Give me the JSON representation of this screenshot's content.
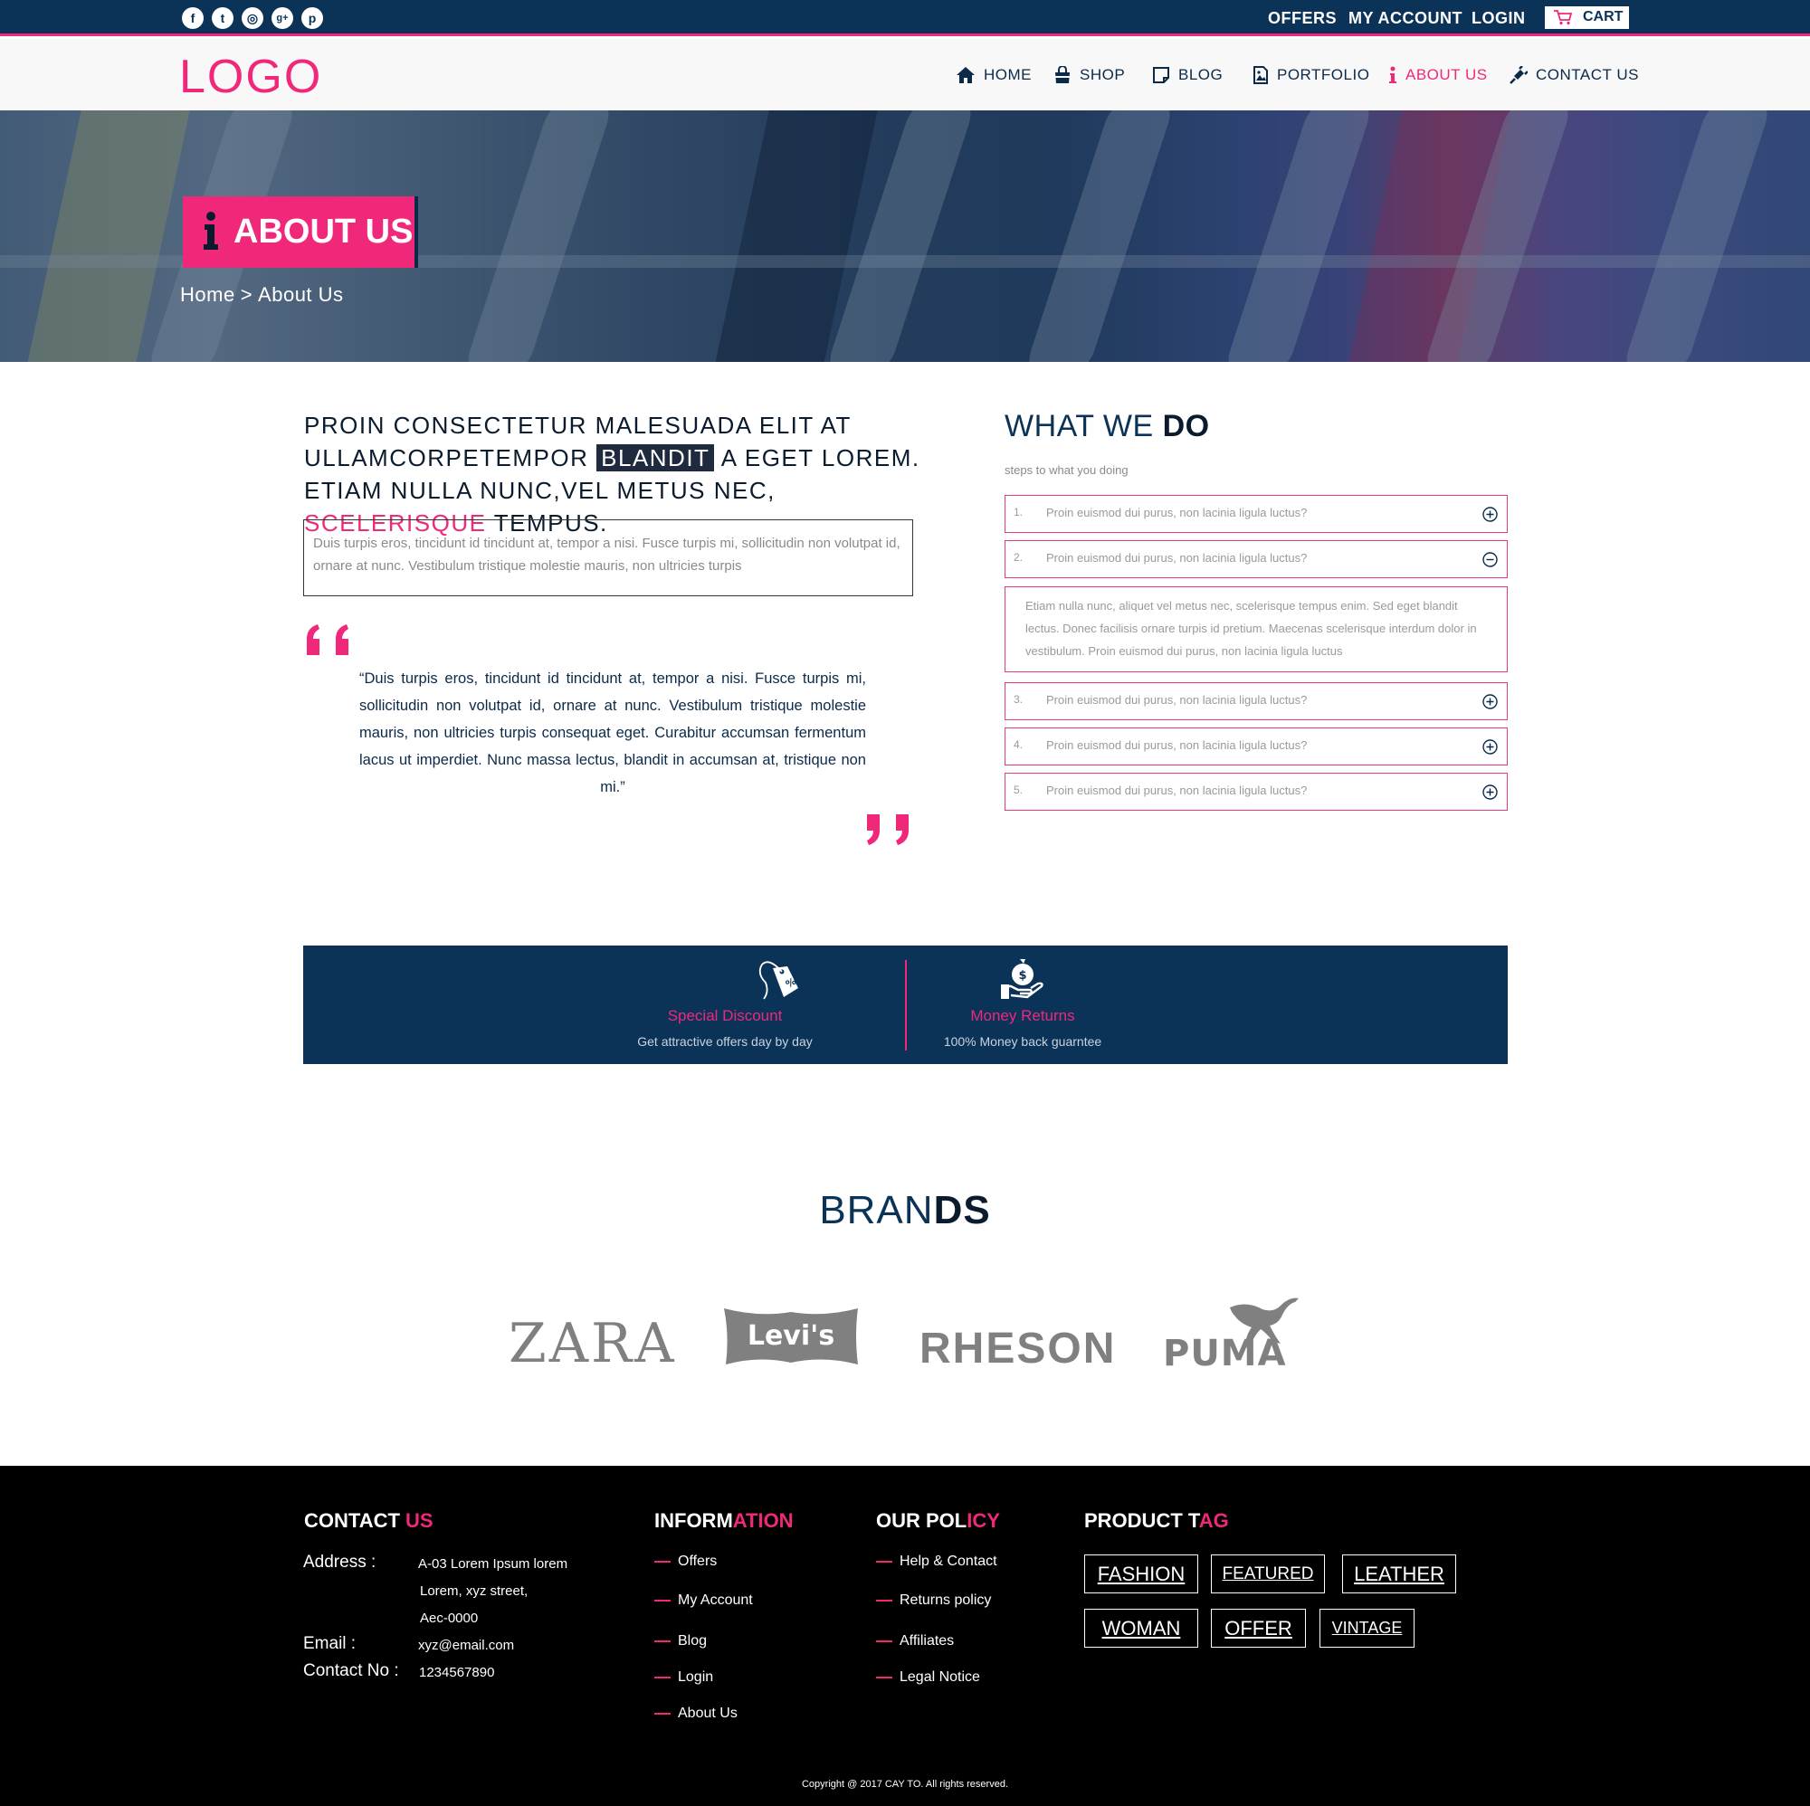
{
  "topbar": {
    "social": [
      "facebook-icon",
      "twitter-icon",
      "instagram-icon",
      "googleplus-icon",
      "pinterest-icon"
    ],
    "social_glyphs": [
      "f",
      "t",
      "◎",
      "g+",
      "p"
    ],
    "links": [
      "OFFERS",
      "MY ACCOUNT",
      "LOGIN"
    ],
    "cart_label": "CART"
  },
  "header": {
    "logo": "LOGO",
    "nav": [
      {
        "label": "HOME",
        "icon": "home-icon"
      },
      {
        "label": "SHOP",
        "icon": "shop-bag-icon"
      },
      {
        "label": "BLOG",
        "icon": "blog-note-icon"
      },
      {
        "label": "PORTFOLIO",
        "icon": "portfolio-image-icon"
      },
      {
        "label": "ABOUT US",
        "icon": "info-icon",
        "active": true
      },
      {
        "label": "CONTACT US",
        "icon": "plug-icon"
      }
    ]
  },
  "hero": {
    "title": "ABOUT US",
    "breadcrumb": [
      "Home",
      ">",
      "About Us"
    ]
  },
  "intro": {
    "heading_part1": "PROIN CONSECTETUR MALESUADA ELIT AT ULLAMCORPETEMPOR",
    "heading_highlight": "BLANDIT",
    "heading_part2": "A EGET LOREM. ETIAM NULLA NUNC,VEL METUS NEC,",
    "heading_pink": "SCELERISQUE",
    "heading_part3": "TEMPUS.",
    "box_text": "Duis turpis eros, tincidunt id tincidunt at, tempor a nisi. Fusce turpis mi, sollicitudin non volutpat id, ornare at nunc. Vestibulum tristique molestie mauris, non ultricies turpis",
    "quote": "“Duis turpis eros, tincidunt id tincidunt at, tempor a nisi. Fusce turpis mi, sollicitudin non volutpat id, ornare at nunc. Vestibulum tristique molestie mauris, non ultricies turpis consequat eget. Curabitur accumsan fermentum lacus ut imperdiet. Nunc massa lectus, blandit in accumsan at, tristique non mi.”"
  },
  "what_we_do": {
    "title_light": "WHAT WE",
    "title_bold": "DO",
    "subtitle": "steps to what you doing",
    "items": [
      {
        "num": "1.",
        "question": "Proin euismod dui purus, non lacinia ligula luctus?",
        "open": false
      },
      {
        "num": "2.",
        "question": "Proin euismod dui purus, non lacinia ligula luctus?",
        "open": true
      },
      {
        "num": "3.",
        "question": "Proin euismod dui purus, non lacinia ligula luctus?",
        "open": false
      },
      {
        "num": "4.",
        "question": "Proin euismod dui purus, non lacinia ligula luctus?",
        "open": false
      },
      {
        "num": "5.",
        "question": "Proin euismod dui purus, non lacinia ligula luctus?",
        "open": false
      }
    ],
    "open_answer": "Etiam nulla nunc, aliquet vel metus nec, scelerisque tempus enim. Sed eget blandit lectus. Donec facilisis ornare turpis id pretium. Maecenas scelerisque interdum dolor in vestibulum. Proin euismod dui purus, non lacinia ligula luctus"
  },
  "features": [
    {
      "icon": "discount-tag-icon",
      "title": "Special Discount",
      "subtitle": "Get attractive offers day by day"
    },
    {
      "icon": "money-hand-icon",
      "title": "Money Returns",
      "subtitle": "100% Money back guarntee"
    }
  ],
  "brands": {
    "title_light": "BRAN",
    "title_bold": "DS",
    "logos": [
      "ZARA",
      "Levi's",
      "RHESON",
      "PUMA"
    ]
  },
  "footer": {
    "contact": {
      "heading_white": "CONTACT ",
      "heading_pink": "US",
      "address_label": "Address :",
      "address_lines": [
        "A-03 Lorem Ipsum lorem",
        "Lorem, xyz street,",
        "Aec-0000"
      ],
      "email_label": "Email :",
      "email": "xyz@email.com",
      "phone_label": "Contact No :",
      "phone": "1234567890"
    },
    "information": {
      "heading_white": "INFORM",
      "heading_pink": "ATION",
      "links": [
        "Offers",
        "My Account",
        "Blog",
        "Login",
        "About Us"
      ]
    },
    "policy": {
      "heading_white": "OUR POL",
      "heading_pink": "ICY",
      "links": [
        "Help & Contact",
        "Returns policy",
        "Affiliates",
        "Legal Notice"
      ]
    },
    "tags": {
      "heading_white": "PRODUCT T",
      "heading_pink": "AG",
      "items": [
        "FASHION",
        "FEATURED",
        "LEATHER",
        "WOMAN",
        "OFFER",
        "VINTAGE"
      ]
    },
    "copyright": "Copyright @ 2017 CAY TO. All rights reserved."
  },
  "colors": {
    "navy": "#0b3358",
    "pink": "#f0287a",
    "footer_bg": "#000000"
  }
}
